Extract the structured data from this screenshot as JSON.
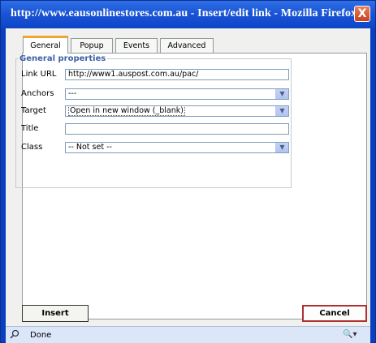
{
  "window": {
    "title": "http://www.eausonlinestores.com.au - Insert/edit link - Mozilla Firefox",
    "close_glyph": "X"
  },
  "tabs": [
    {
      "label": "General",
      "active": true
    },
    {
      "label": "Popup",
      "active": false
    },
    {
      "label": "Events",
      "active": false
    },
    {
      "label": "Advanced",
      "active": false
    }
  ],
  "general_properties": {
    "legend": "General properties",
    "link_url": {
      "label": "Link URL",
      "value": "http://www1.auspost.com.au/pac/"
    },
    "anchors": {
      "label": "Anchors",
      "selected": "---"
    },
    "target": {
      "label": "Target",
      "selected": "Open in new window (_blank)"
    },
    "title": {
      "label": "Title",
      "value": ""
    },
    "class": {
      "label": "Class",
      "selected": "-- Not set --"
    }
  },
  "buttons": {
    "insert": "Insert",
    "cancel": "Cancel"
  },
  "statusbar": {
    "text": "Done",
    "search_icon": "magnifier-icon",
    "zoom_icon": "zoom-icon"
  },
  "colors": {
    "titlebar": "#1a55d6",
    "active_tab_accent": "#f2a431",
    "legend": "#3c5fa8",
    "close_button": "#c5411e"
  }
}
